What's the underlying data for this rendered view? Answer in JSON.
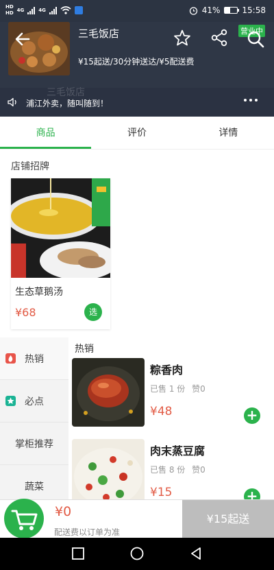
{
  "status_bar": {
    "network_top": "HD",
    "network_bottom": "HD",
    "signal_1": "4G",
    "signal_2": "4G",
    "battery": "41%",
    "time": "15:58"
  },
  "shop": {
    "name": "三毛饭店",
    "info": "¥15起送/30分钟送达/¥5配送费",
    "status_badge": "营业中",
    "notice": "浦江外卖，随叫随到！"
  },
  "tabs": [
    {
      "label": "商品",
      "active": true
    },
    {
      "label": "评价",
      "active": false
    },
    {
      "label": "详情",
      "active": false
    }
  ],
  "signature": {
    "title": "店铺招牌",
    "item": {
      "name": "生态草鹅汤",
      "price": "¥68",
      "select_label": "选"
    }
  },
  "sidebar": {
    "items": [
      {
        "label": "热销",
        "icon": "fire-icon",
        "icon_color": "#e8544a"
      },
      {
        "label": "必点",
        "icon": "star-icon",
        "icon_color": "#1ab394"
      },
      {
        "label": "掌柜推荐"
      },
      {
        "label": "蔬菜"
      }
    ]
  },
  "menu": {
    "category": "热销",
    "dishes": [
      {
        "name": "粽香肉",
        "sold": "已售 1 份",
        "likes": "赞0",
        "price": "¥48"
      },
      {
        "name": "肉末蒸豆腐",
        "sold": "已售 8 份",
        "likes": "赞0",
        "price": "¥15"
      }
    ]
  },
  "cart": {
    "total": "¥0",
    "note": "配送费以订单为准",
    "checkout_label": "¥15起送"
  },
  "colors": {
    "accent": "#2bb24c",
    "price": "#e25b45",
    "header_bg": "#2f3746"
  }
}
